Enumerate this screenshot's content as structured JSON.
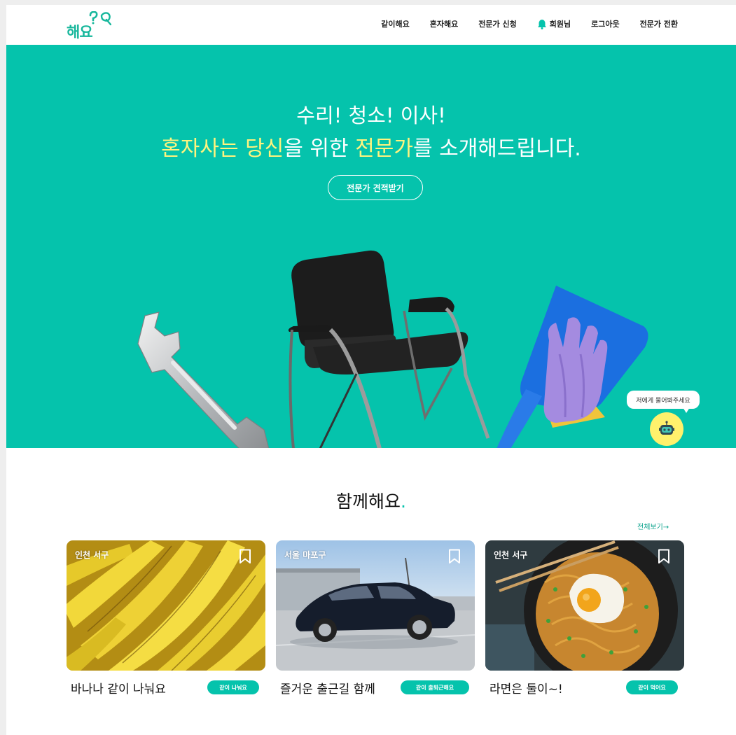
{
  "brand": {
    "logo_text": "해요"
  },
  "nav": {
    "items": [
      "같이해요",
      "혼자해요",
      "전문가 신청",
      "회원님",
      "로그아웃",
      "전문가 전환"
    ]
  },
  "hero": {
    "line1": "수리! 청소! 이사!",
    "line2_parts": [
      "혼자사는 ",
      "당신",
      "을 위한 ",
      "전문가",
      "를 소개해드립니다."
    ],
    "cta_label": "전문가 견적받기"
  },
  "chatbot": {
    "bubble_text": "저에게 물어봐주세요"
  },
  "section": {
    "title": "함께해요",
    "title_dot": ".",
    "see_all": "전체보기→"
  },
  "cards": [
    {
      "location": "인천 서구",
      "title": "바나나 같이 나눠요",
      "button": "같이 나눠요",
      "image": "bananas"
    },
    {
      "location": "서울 마포구",
      "title": "즐거운 출근길 함께",
      "button": "같이 출퇴근해요",
      "image": "car"
    },
    {
      "location": "인천 서구",
      "title": "라면은 둘이~!",
      "button": "같이 먹어요",
      "image": "ramen"
    }
  ],
  "colors": {
    "accent": "#05c3ac",
    "highlight": "#fff47e",
    "bot": "#fff16c"
  }
}
